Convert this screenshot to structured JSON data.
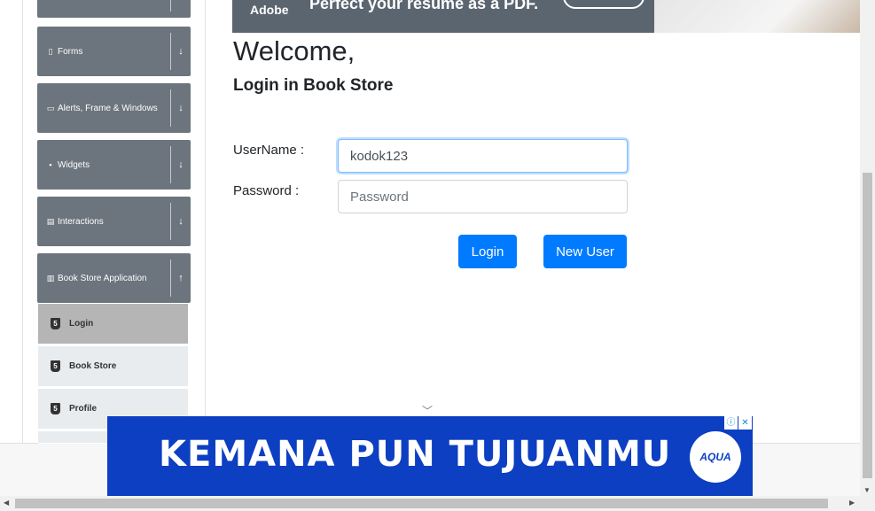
{
  "sidebar": {
    "groups": [
      {
        "label": "Forms",
        "icon": "document-icon",
        "chevron": "↓"
      },
      {
        "label": "Alerts, Frame & Windows",
        "icon": "window-icon",
        "chevron": "↓"
      },
      {
        "label": "Widgets",
        "icon": "grid-icon",
        "chevron": "↓"
      },
      {
        "label": "Interactions",
        "icon": "list-icon",
        "chevron": "↓"
      },
      {
        "label": "Book Store Application",
        "icon": "library-icon",
        "chevron": "↑"
      }
    ],
    "items": [
      {
        "label": "Login",
        "icon": "html5-icon",
        "active": true
      },
      {
        "label": "Book Store",
        "icon": "html5-icon",
        "active": false
      },
      {
        "label": "Profile",
        "icon": "html5-icon",
        "active": false
      }
    ]
  },
  "top_ad": {
    "brand": "Adobe",
    "headline": "Perfect your resume as a PDF."
  },
  "main": {
    "title": "Welcome,",
    "subtitle": "Login in Book Store",
    "username_label": "UserName :",
    "username_value": "kodok123",
    "password_label": "Password :",
    "password_placeholder": "Password",
    "login_button": "Login",
    "new_user_button": "New User"
  },
  "bottom_ad": {
    "text": "KEMANA PUN TUJUANMU",
    "logo_text": "AQUA",
    "background": "#0d3fc2"
  },
  "colors": {
    "sidebar_header": "#6c757d",
    "primary": "#007bff"
  }
}
